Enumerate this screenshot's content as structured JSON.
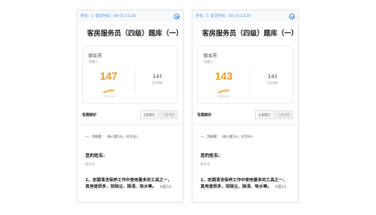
{
  "colors": {
    "accent": "#4a90e2",
    "score": "#f29b2e"
  },
  "panels": [
    {
      "topbar": {
        "seq": "序号：1",
        "submit_time": "提交时间：04-05 11:18"
      },
      "title": "客房服务员（四级）题库（一）",
      "card": {
        "name": "欧业芳",
        "role": "答题人",
        "score": "147",
        "score_sub": "总分计分",
        "total": "147",
        "total_label": "答对题数"
      },
      "analysis": {
        "label": "答题解析",
        "btn_all": "全部题目",
        "btn_wrong": "只看错题"
      },
      "section": "一、判断题：（每小题1分，共50分）",
      "name_q": "您的姓名:",
      "name_a": "欧业芳",
      "q1_text": "1、定期清洁保养工作中使用最多的工具之一，其用途很多，如除尘、除渍、吸水等。",
      "q1_pts": "分值1分"
    },
    {
      "topbar": {
        "seq": "序号：5",
        "submit_time": "提交时间：04-10 13:36"
      },
      "title": "客房服务员（四级）题库（一）",
      "card": {
        "name": "欧业芳",
        "role": "答题人",
        "score": "143",
        "score_sub": "总分计分",
        "total": "143",
        "total_label": "答对题数"
      },
      "analysis": {
        "label": "答题解析",
        "btn_all": "全部题目",
        "btn_wrong": "只看错题"
      },
      "section": "一、判断题：（每小题1分，共50分）",
      "name_q": "您的姓名:",
      "name_a": "欧业芳",
      "q1_text": "1、定期清洁保养工作中使用最多的工具之一，其用途很多，如除尘、除渍、吸水等。",
      "q1_pts": "分值1分"
    }
  ]
}
